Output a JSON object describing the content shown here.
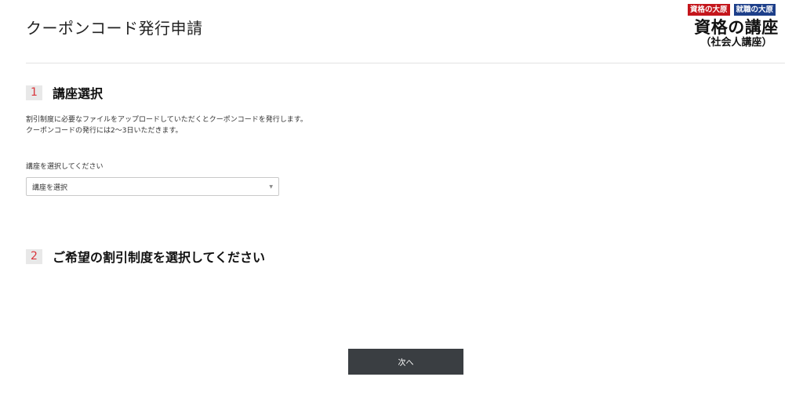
{
  "header": {
    "title": "クーポンコード発行申請",
    "logo": {
      "badge_left": "資格の大原",
      "badge_right": "就職の大原",
      "main": "資格の講座",
      "sub": "（社会人講座）",
      "colors": {
        "badge_left": "#c4161c",
        "badge_right": "#1d3f8a"
      }
    }
  },
  "section1": {
    "number": "1",
    "title": "講座選択",
    "description": [
      "割引制度に必要なファイルをアップロードしていただくとクーポンコードを発行します。",
      "クーポンコードの発行には2〜3日いただきます。"
    ],
    "select_label": "講座を選択してください",
    "select_value": "講座を選択",
    "select_icon": "caret-down-icon"
  },
  "section2": {
    "number": "2",
    "title": "ご希望の割引制度を選択してください"
  },
  "footer": {
    "next_label": "次へ"
  },
  "colors": {
    "accent": "#d9343a",
    "button_bg": "#3a3e42"
  }
}
